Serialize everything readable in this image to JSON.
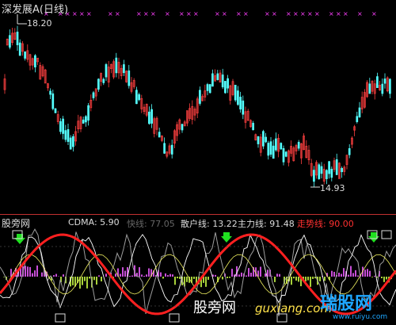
{
  "main_chart": {
    "title": "深发展A(日线)",
    "high_label": "18.20",
    "low_label": "14.93"
  },
  "indicator": {
    "name": "股旁网",
    "cdma": "CDMA: 5.90",
    "kuaixian": "快线: 77.05",
    "sanhuxian": "散户线: 13.22",
    "zhulixian": "主力线: 91.48",
    "zoushixian": "走势线: 90.00"
  },
  "watermark": {
    "text1": "股旁网",
    "text2": "guxiang.com",
    "text3": "瑞股网",
    "text4": "www.ruiyu.com"
  },
  "colors": {
    "up": "#ff4040",
    "down": "#54ffff",
    "kuaixian": "#9e9e9e",
    "sanhuxian": "#ffffff",
    "zhulixian": "#ff2020",
    "zoushixian": "#ff2020",
    "marker": "#ff40ff"
  }
}
